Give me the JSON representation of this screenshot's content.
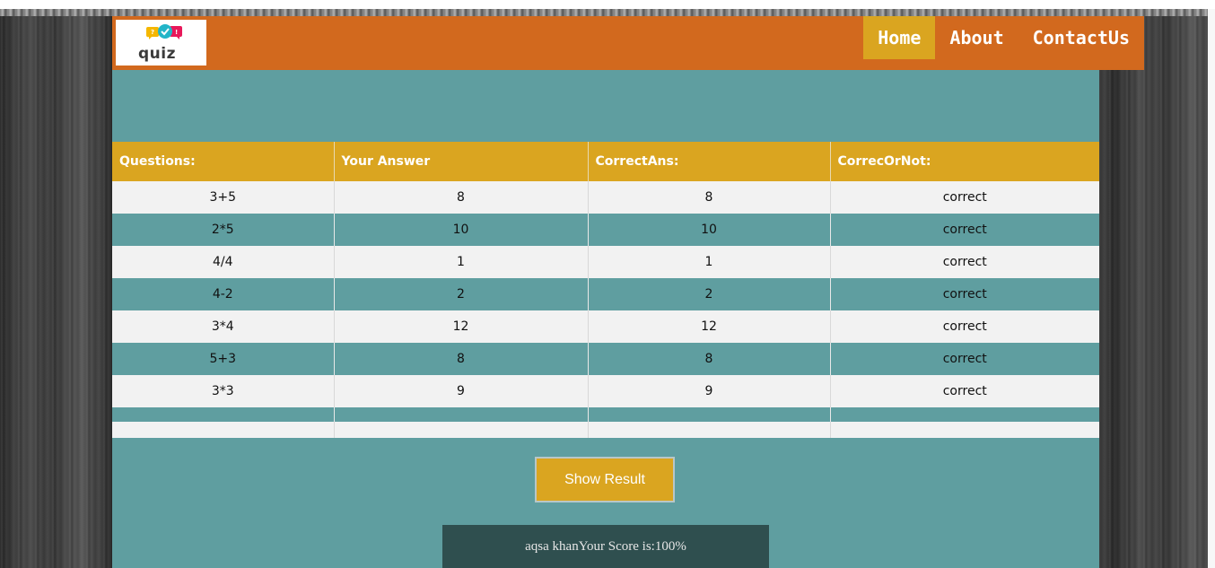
{
  "header": {
    "logo_text": "quiz",
    "nav": [
      {
        "label": "Home",
        "active": true
      },
      {
        "label": "About",
        "active": false
      },
      {
        "label": "ContactUs",
        "active": false
      }
    ]
  },
  "table": {
    "headers": [
      "Questions:",
      "Your Answer",
      "CorrectAns:",
      "CorrecOrNot:"
    ],
    "rows": [
      [
        "3+5",
        "8",
        "8",
        "correct"
      ],
      [
        "2*5",
        "10",
        "10",
        "correct"
      ],
      [
        "4/4",
        "1",
        "1",
        "correct"
      ],
      [
        "4-2",
        "2",
        "2",
        "correct"
      ],
      [
        "3*4",
        "12",
        "12",
        "correct"
      ],
      [
        "5+3",
        "8",
        "8",
        "correct"
      ],
      [
        "3*3",
        "9",
        "9",
        "correct"
      ]
    ]
  },
  "actions": {
    "show_result_label": "Show Result"
  },
  "result": {
    "score_text": "aqsa khanYour Score is:100%"
  },
  "colors": {
    "header_bg": "#d2691e",
    "accent": "#daa520",
    "panel": "#5f9ea0",
    "score_bg": "#2f4f4f"
  }
}
